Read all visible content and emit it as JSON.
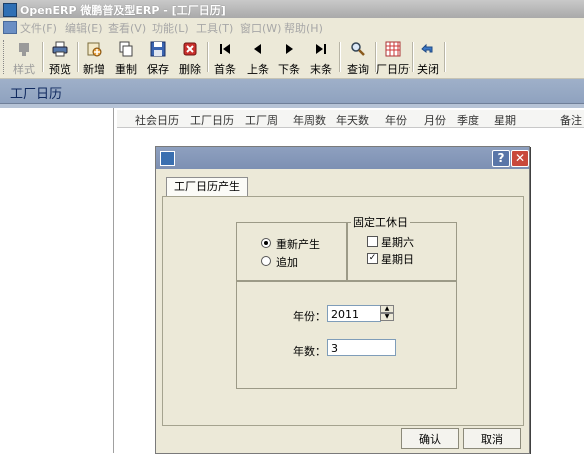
{
  "window": {
    "title": "OpenERP  微鹏普及型ERP - [工厂日历]"
  },
  "menu": [
    "文件(F)",
    "编辑(E)",
    "查看(V)",
    "功能(L)",
    "工具(T)",
    "窗口(W)",
    "帮助(H)"
  ],
  "toolbar": {
    "style": "样式",
    "preview": "预览",
    "add": "新增",
    "copy": "重制",
    "save": "保存",
    "delete": "删除",
    "first": "首条",
    "prev": "上条",
    "next": "下条",
    "last": "末条",
    "query": "查询",
    "factory_calendar": "厂日历记",
    "close": "关闭"
  },
  "page": {
    "title": "工厂日历"
  },
  "grid": {
    "columns": [
      "社会日历",
      "工厂日历",
      "工厂周",
      "年周数",
      "年天数",
      "年份",
      "月份",
      "季度",
      "星期",
      "备注"
    ]
  },
  "dialog": {
    "tab": "工厂日历产生",
    "group_title": "固定工休日",
    "mode_regen": "重新产生",
    "mode_append": "追加",
    "saturday": "星期六",
    "sunday": "星期日",
    "year_label": "年份：",
    "year_value": "2011",
    "count_label": "年数：",
    "count_value": "3",
    "ok": "确认",
    "cancel": "取消",
    "help_glyph": "?",
    "close_glyph": "✕"
  },
  "state": {
    "mode": "regen",
    "saturday_checked": false,
    "sunday_checked": true
  },
  "colors": {
    "accent": "#8fa2bf",
    "close_button": "#c9493b"
  }
}
